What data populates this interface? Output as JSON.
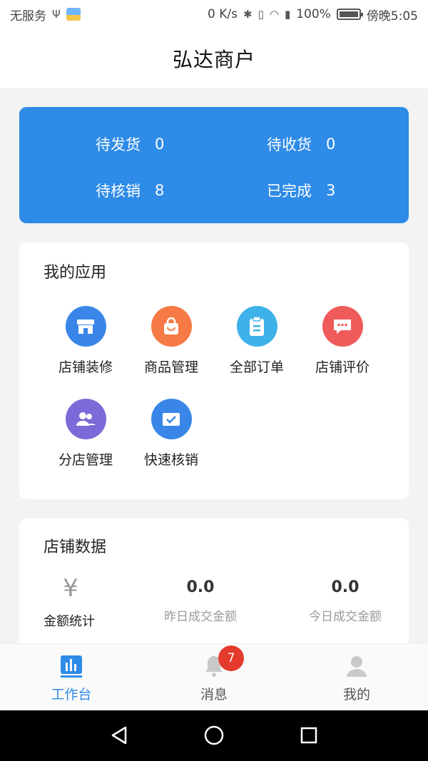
{
  "status_bar": {
    "carrier": "无服务",
    "network_speed": "0 K/s",
    "battery": "100%",
    "time": "傍晚5:05"
  },
  "header": {
    "title": "弘达商户"
  },
  "summary": [
    {
      "label": "待发货",
      "value": "0"
    },
    {
      "label": "待收货",
      "value": "0"
    },
    {
      "label": "待核销",
      "value": "8"
    },
    {
      "label": "已完成",
      "value": "3"
    }
  ],
  "my_apps": {
    "title": "我的应用",
    "items": [
      {
        "label": "店铺装修",
        "icon": "store-icon",
        "color": "#3a86e8"
      },
      {
        "label": "商品管理",
        "icon": "shopping-bag-icon",
        "color": "#f57a45"
      },
      {
        "label": "全部订单",
        "icon": "clipboard-icon",
        "color": "#3fb1e9"
      },
      {
        "label": "店铺评价",
        "icon": "chat-bubble-icon",
        "color": "#ef5b5b"
      },
      {
        "label": "分店管理",
        "icon": "users-icon",
        "color": "#7b6bd8"
      },
      {
        "label": "快速核销",
        "icon": "check-envelope-icon",
        "color": "#3a86e8"
      }
    ]
  },
  "store_data": {
    "title": "店铺数据",
    "amount_label": "金额统计",
    "amount_glyph": "¥",
    "yesterday": {
      "value": "0.0",
      "label": "昨日成交金额"
    },
    "today": {
      "value": "0.0",
      "label": "今日成交金额"
    }
  },
  "tab_bar": {
    "items": [
      {
        "label": "工作台",
        "icon": "bar-chart-icon",
        "active": true
      },
      {
        "label": "消息",
        "icon": "bell-icon",
        "active": false
      },
      {
        "label": "我的",
        "icon": "person-icon",
        "active": false
      }
    ],
    "message_badge": "7"
  },
  "colors": {
    "accent": "#2e8be7",
    "tab_active": "#2e8be7",
    "tab_inactive": "#c9c9c9",
    "badge": "#e53b2c"
  }
}
